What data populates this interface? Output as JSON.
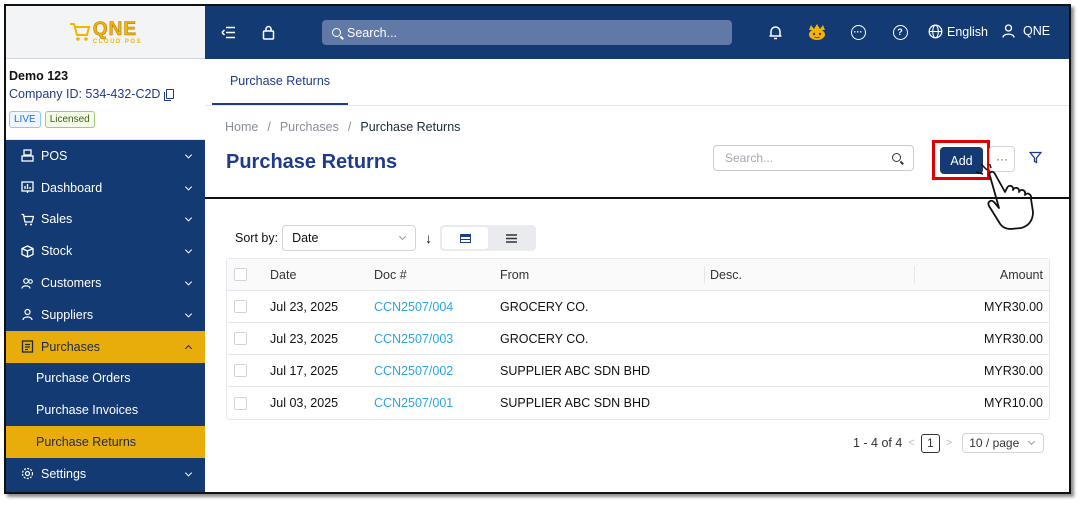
{
  "brand": {
    "logo_main": "QNE",
    "logo_sub": "CLOUD POS"
  },
  "company": {
    "name": "Demo 123",
    "id_text": "Company ID: 534-432-C2D",
    "badge_live": "LIVE",
    "badge_licensed": "Licensed"
  },
  "sidebar": {
    "items": [
      {
        "label": "POS",
        "icon": "pos-icon"
      },
      {
        "label": "Dashboard",
        "icon": "dashboard-icon"
      },
      {
        "label": "Sales",
        "icon": "sales-icon"
      },
      {
        "label": "Stock",
        "icon": "stock-icon"
      },
      {
        "label": "Customers",
        "icon": "customers-icon"
      },
      {
        "label": "Suppliers",
        "icon": "suppliers-icon"
      },
      {
        "label": "Purchases",
        "icon": "purchases-icon"
      },
      {
        "label": "Settings",
        "icon": "settings-icon"
      }
    ],
    "sub_items": [
      {
        "label": "Purchase Orders"
      },
      {
        "label": "Purchase Invoices"
      },
      {
        "label": "Purchase Returns"
      }
    ]
  },
  "topbar": {
    "search_placeholder": "Search...",
    "language": "English",
    "user": "QNE"
  },
  "tabs": [
    {
      "label": "Purchase Returns"
    }
  ],
  "breadcrumb": {
    "home": "Home",
    "sep": "/",
    "section": "Purchases",
    "current": "Purchase Returns"
  },
  "page": {
    "title": "Purchase Returns",
    "search_placeholder": "Search...",
    "add_label": "Add",
    "more_label": "···"
  },
  "sort": {
    "label": "Sort by:",
    "value": "Date"
  },
  "table": {
    "headers": {
      "date": "Date",
      "doc": "Doc #",
      "from": "From",
      "desc": "Desc.",
      "amount": "Amount"
    },
    "rows": [
      {
        "date": "Jul 23, 2025",
        "doc": "CCN2507/004",
        "from": "GROCERY CO.",
        "desc": "",
        "amount": "MYR30.00"
      },
      {
        "date": "Jul 23, 2025",
        "doc": "CCN2507/003",
        "from": "GROCERY CO.",
        "desc": "",
        "amount": "MYR30.00"
      },
      {
        "date": "Jul 17, 2025",
        "doc": "CCN2507/002",
        "from": "SUPPLIER ABC SDN BHD",
        "desc": "",
        "amount": "MYR30.00"
      },
      {
        "date": "Jul 03, 2025",
        "doc": "CCN2507/001",
        "from": "SUPPLIER ABC SDN BHD",
        "desc": "",
        "amount": "MYR10.00"
      }
    ]
  },
  "pagination": {
    "range": "1 - 4 of 4",
    "page": "1",
    "page_size": "10 / page"
  },
  "colors": {
    "navy": "#133a73",
    "gold": "#e8ac0b",
    "link": "#2ea5e0",
    "highlight": "#e00000"
  }
}
